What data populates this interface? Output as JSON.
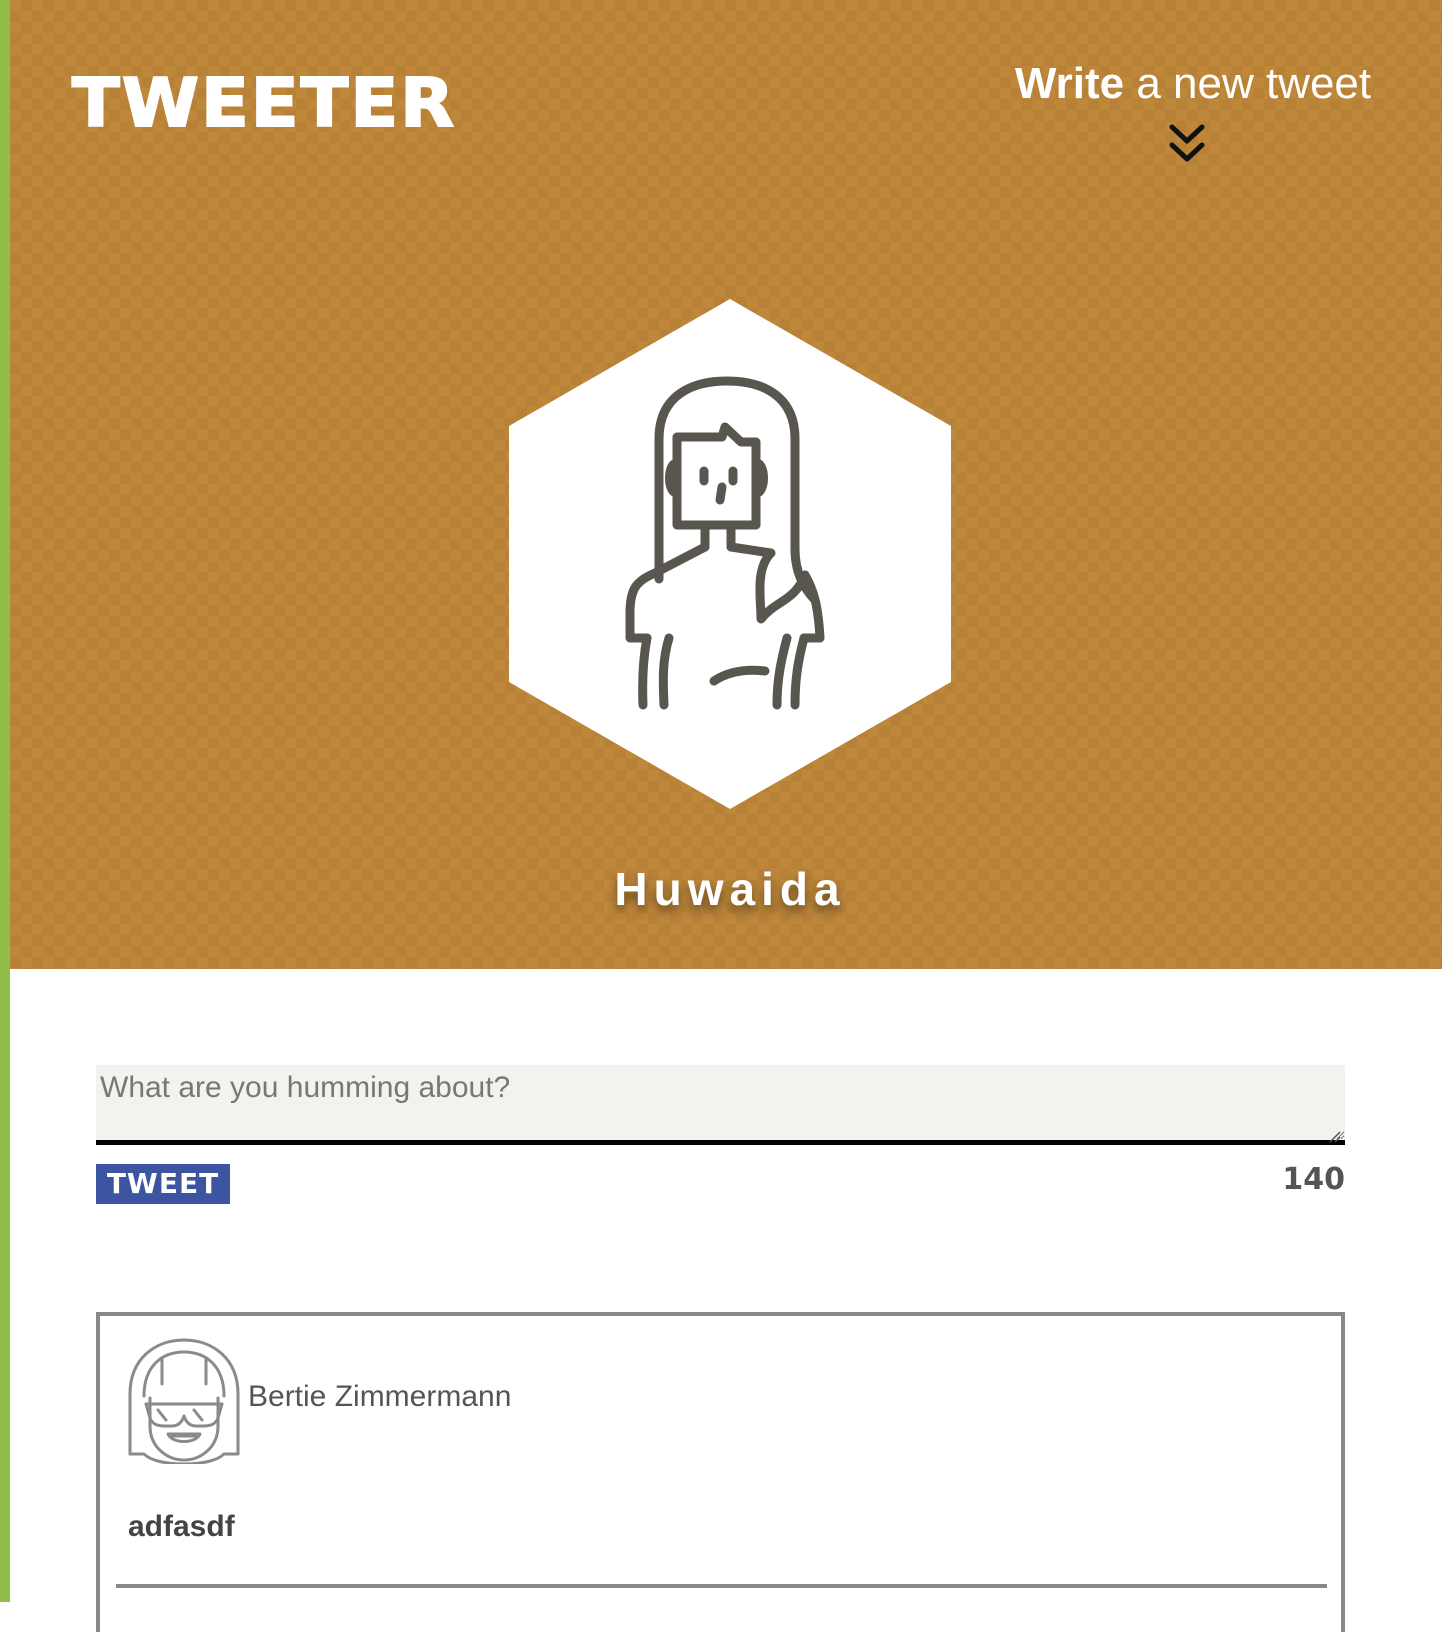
{
  "header": {
    "logo": "TWEETER",
    "write_link": {
      "strong": "Write",
      "rest": " a new tweet"
    },
    "background_color": "#be873a"
  },
  "profile": {
    "name": "Huwaida",
    "avatar_icon": "woman-avatar-icon"
  },
  "composer": {
    "placeholder": "What are you humming about?",
    "value": "",
    "button_label": "TWEET",
    "char_count": "140",
    "button_color": "#3d54a1"
  },
  "tweets": [
    {
      "author": "Bertie Zimmermann",
      "avatar_icon": "man-with-sunglasses-avatar-icon",
      "text": "adfasdf"
    }
  ],
  "accent_stripe_color": "#8fbf47"
}
